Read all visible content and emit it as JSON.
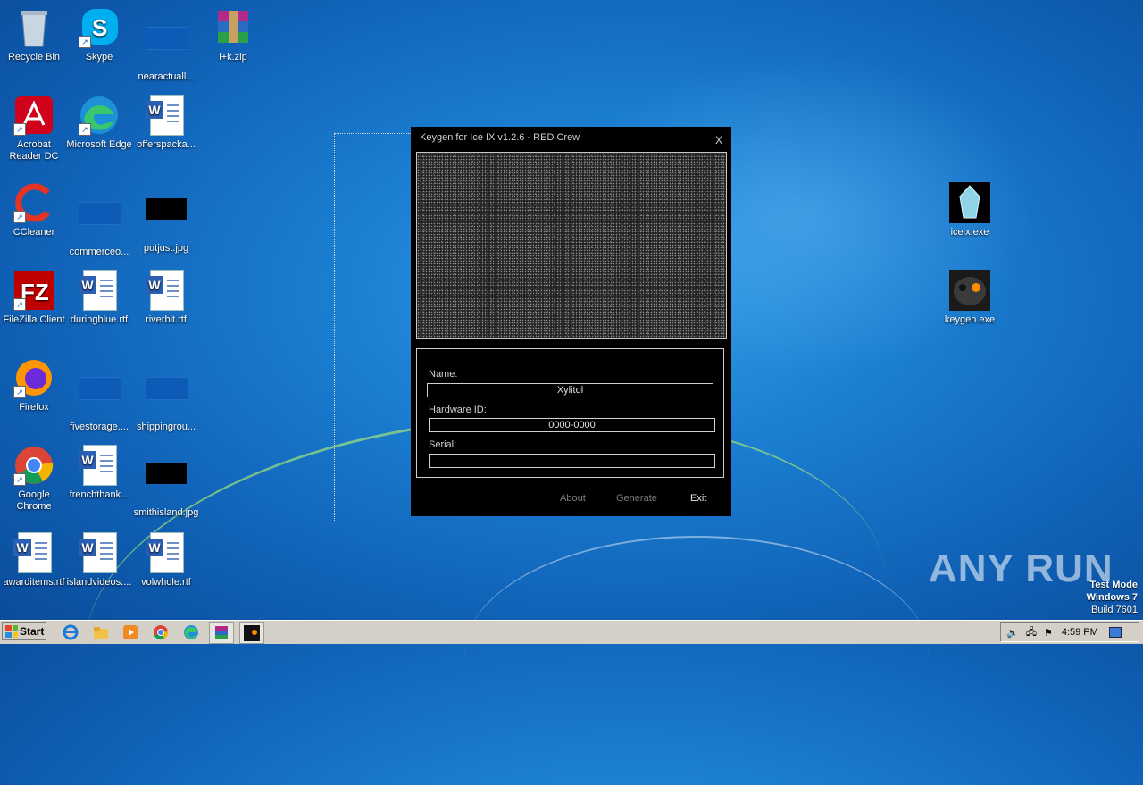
{
  "desktop_icons": [
    {
      "label": "Recycle Bin",
      "icon": "recycle-bin-icon"
    },
    {
      "label": "Skype",
      "icon": "skype-icon"
    },
    {
      "label": "nearactuall...",
      "icon": "file-icon"
    },
    {
      "label": "i+k.zip",
      "icon": "winrar-archive-icon"
    },
    {
      "label": "Acrobat Reader DC",
      "icon": "acrobat-reader-icon"
    },
    {
      "label": "Microsoft Edge",
      "icon": "edge-icon"
    },
    {
      "label": "offerspacka...",
      "icon": "word-document-icon"
    },
    {
      "label": "CCleaner",
      "icon": "ccleaner-icon"
    },
    {
      "label": "commerceo...",
      "icon": "file-icon"
    },
    {
      "label": "putjust.jpg",
      "icon": "image-icon"
    },
    {
      "label": "FileZilla Client",
      "icon": "filezilla-icon"
    },
    {
      "label": "duringblue.rtf",
      "icon": "word-document-icon"
    },
    {
      "label": "riverbit.rtf",
      "icon": "word-document-icon"
    },
    {
      "label": "Firefox",
      "icon": "firefox-icon"
    },
    {
      "label": "fivestorage....",
      "icon": "file-icon"
    },
    {
      "label": "shippingrou...",
      "icon": "file-icon"
    },
    {
      "label": "Google Chrome",
      "icon": "chrome-icon"
    },
    {
      "label": "frenchthank...",
      "icon": "word-document-icon"
    },
    {
      "label": "smithisland.jpg",
      "icon": "image-icon"
    },
    {
      "label": "awarditems.rtf",
      "icon": "word-document-icon"
    },
    {
      "label": "islandvideos....",
      "icon": "word-document-icon"
    },
    {
      "label": "volwhole.rtf",
      "icon": "word-document-icon"
    },
    {
      "label": "iceix.exe",
      "icon": "crystal-exe-icon"
    },
    {
      "label": "keygen.exe",
      "icon": "skull-exe-icon"
    }
  ],
  "keygen": {
    "title": "Keygen for Ice IX v1.2.6 - RED Crew",
    "close_label": "X",
    "name_label": "Name:",
    "name_value": "Xylitol",
    "hwid_label": "Hardware ID:",
    "hwid_value": "0000-0000",
    "serial_label": "Serial:",
    "serial_value": "",
    "about_label": "About",
    "generate_label": "Generate",
    "exit_label": "Exit"
  },
  "watermark": {
    "brand": "ANY RUN",
    "mode": "Test Mode",
    "os": "Windows 7",
    "build": "Build 7601"
  },
  "taskbar": {
    "start_label": "Start",
    "pinned": [
      "internet-explorer-icon",
      "explorer-folder-icon",
      "media-player-icon",
      "chrome-icon",
      "edge-icon",
      "winrar-icon",
      "keygen-app-icon"
    ],
    "clock": "4:59 PM"
  },
  "colors": {
    "desktop_blue": "#1a7dd0",
    "keygen_bg": "#000000",
    "taskbar": "#d4d0c8"
  }
}
